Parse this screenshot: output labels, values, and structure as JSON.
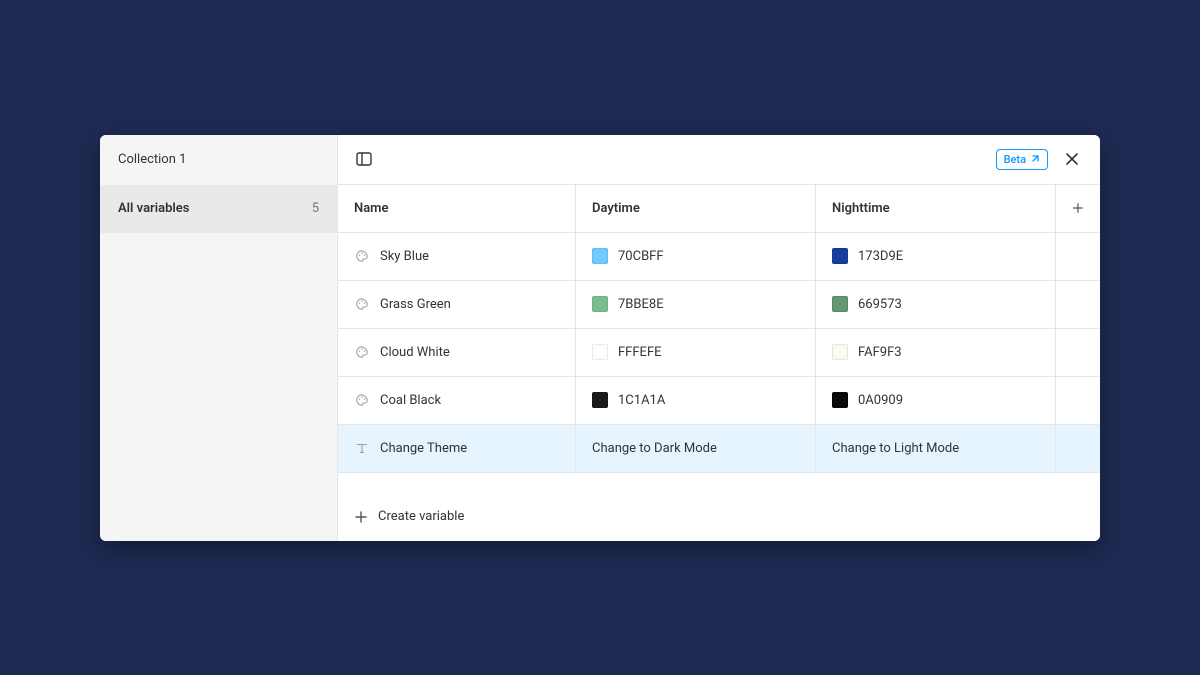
{
  "sidebar": {
    "collection_title": "Collection 1",
    "all_variables_label": "All variables",
    "all_variables_count": "5"
  },
  "topbar": {
    "beta_label": "Beta"
  },
  "columns": {
    "name": "Name",
    "mode1": "Daytime",
    "mode2": "Nighttime"
  },
  "rows": [
    {
      "type": "color",
      "name": "Sky Blue",
      "mode1_hex": "70CBFF",
      "mode1_swatch": "#70CBFF",
      "mode2_hex": "173D9E",
      "mode2_swatch": "#173D9E"
    },
    {
      "type": "color",
      "name": "Grass Green",
      "mode1_hex": "7BBE8E",
      "mode1_swatch": "#7BBE8E",
      "mode2_hex": "669573",
      "mode2_swatch": "#669573"
    },
    {
      "type": "color",
      "name": "Cloud White",
      "mode1_hex": "FFFEFE",
      "mode1_swatch": "#FFFEFE",
      "mode2_hex": "FAF9F3",
      "mode2_swatch": "#FAF9F3"
    },
    {
      "type": "color",
      "name": "Coal Black",
      "mode1_hex": "1C1A1A",
      "mode1_swatch": "#1C1A1A",
      "mode2_hex": "0A0909",
      "mode2_swatch": "#0A0909"
    },
    {
      "type": "text",
      "name": "Change Theme",
      "mode1_text": "Change to Dark Mode",
      "mode2_text": "Change to Light Mode",
      "selected": true
    }
  ],
  "footer": {
    "create_variable_label": "Create variable"
  }
}
